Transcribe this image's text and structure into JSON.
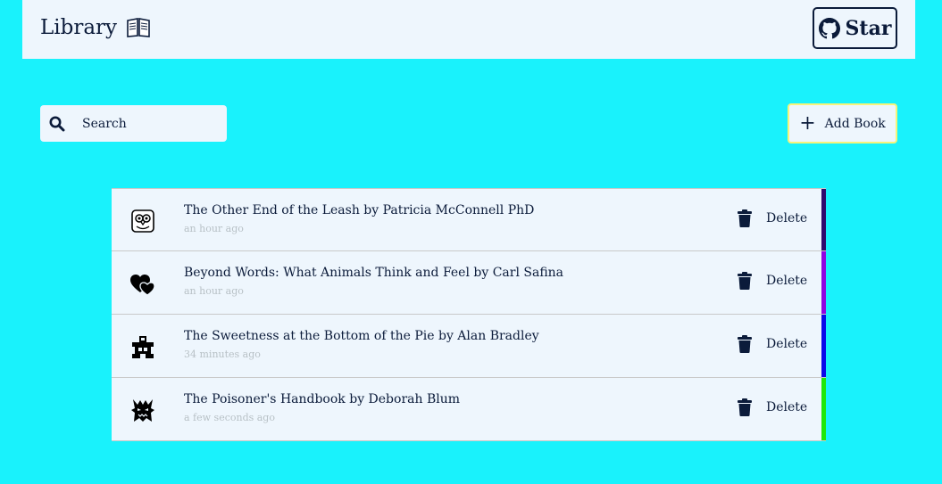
{
  "navbar": {
    "brand": "Library",
    "star_label": "Star"
  },
  "toolbar": {
    "search_placeholder": "Search",
    "add_label": "Add Book"
  },
  "books": [
    {
      "title": "The Other End of the Leash by Patricia McConnell PhD",
      "time": "an hour ago",
      "icon": "owl-icon",
      "color": "#2e0a6b",
      "delete_label": "Delete"
    },
    {
      "title": "Beyond Words: What Animals Think and Feel by Carl Safina",
      "time": "an hour ago",
      "icon": "hearts-icon",
      "color": "#8f05e0",
      "delete_label": "Delete"
    },
    {
      "title": "The Sweetness at the Bottom of the Pie by Alan Bradley",
      "time": "34 minutes ago",
      "icon": "castle-icon",
      "color": "#0a0ae8",
      "delete_label": "Delete"
    },
    {
      "title": "The Poisoner's Handbook by Deborah Blum",
      "time": "a few seconds ago",
      "icon": "monster-icon",
      "color": "#1fe80a",
      "delete_label": "Delete"
    }
  ]
}
